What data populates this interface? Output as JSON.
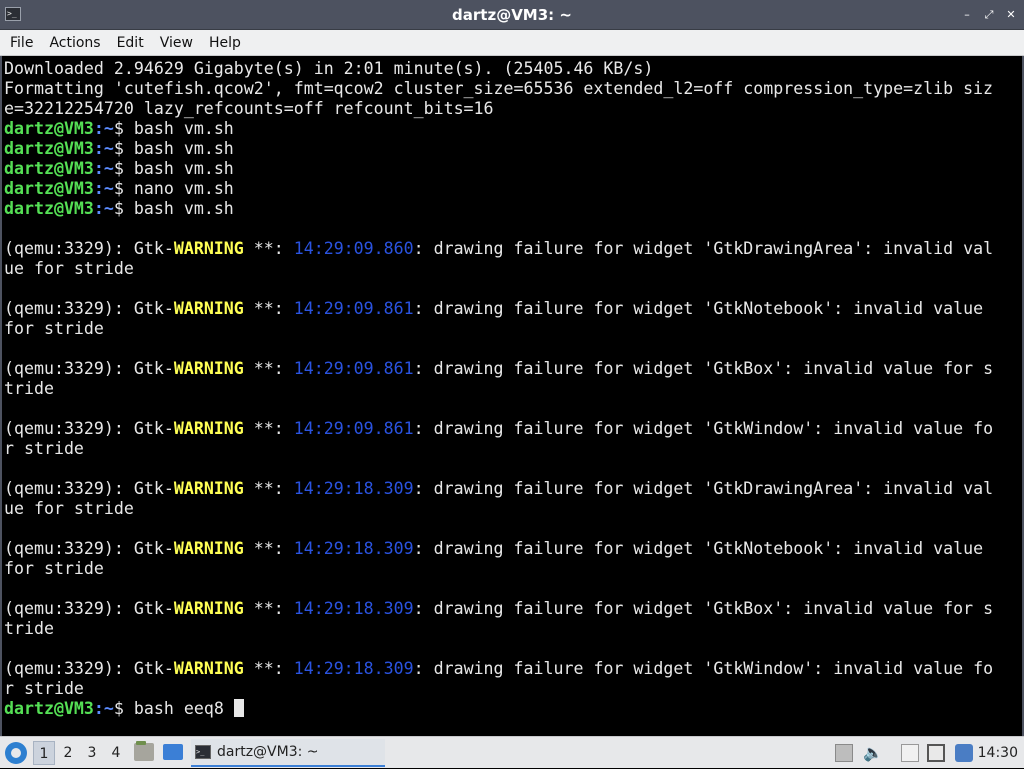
{
  "window": {
    "title": "dartz@VM3: ~",
    "app_icon_glyph": ">_",
    "buttons": {
      "minimize": "–",
      "restore": "⤢",
      "close": "✕"
    }
  },
  "menu": {
    "items": [
      "File",
      "Actions",
      "Edit",
      "View",
      "Help"
    ]
  },
  "terminal": {
    "prompt_user": "dartz@VM3",
    "prompt_path": ":~",
    "prompt_symbol": "$ ",
    "lines": [
      {
        "kind": "text",
        "text": "Downloaded 2.94629 Gigabyte(s) in 2:01 minute(s). (25405.46 KB/s)"
      },
      {
        "kind": "text",
        "text": "Formatting 'cutefish.qcow2', fmt=qcow2 cluster_size=65536 extended_l2=off compression_type=zlib siz"
      },
      {
        "kind": "text",
        "text": "e=32212254720 lazy_refcounts=off refcount_bits=16"
      },
      {
        "kind": "prompt",
        "cmd": "bash vm.sh"
      },
      {
        "kind": "prompt",
        "cmd": "bash vm.sh"
      },
      {
        "kind": "prompt",
        "cmd": "bash vm.sh"
      },
      {
        "kind": "prompt",
        "cmd": "nano vm.sh"
      },
      {
        "kind": "prompt",
        "cmd": "bash vm.sh"
      },
      {
        "kind": "blank"
      },
      {
        "kind": "warn",
        "pre": "(qemu:3329): Gtk-",
        "word": "WARNING",
        "mid": " **: ",
        "ts": "14:29:09.860",
        "post": ": drawing failure for widget 'GtkDrawingArea': invalid val"
      },
      {
        "kind": "text",
        "text": "ue for stride"
      },
      {
        "kind": "blank"
      },
      {
        "kind": "warn",
        "pre": "(qemu:3329): Gtk-",
        "word": "WARNING",
        "mid": " **: ",
        "ts": "14:29:09.861",
        "post": ": drawing failure for widget 'GtkNotebook': invalid value"
      },
      {
        "kind": "text",
        "text": "for stride"
      },
      {
        "kind": "blank"
      },
      {
        "kind": "warn",
        "pre": "(qemu:3329): Gtk-",
        "word": "WARNING",
        "mid": " **: ",
        "ts": "14:29:09.861",
        "post": ": drawing failure for widget 'GtkBox': invalid value for s"
      },
      {
        "kind": "text",
        "text": "tride"
      },
      {
        "kind": "blank"
      },
      {
        "kind": "warn",
        "pre": "(qemu:3329): Gtk-",
        "word": "WARNING",
        "mid": " **: ",
        "ts": "14:29:09.861",
        "post": ": drawing failure for widget 'GtkWindow': invalid value fo"
      },
      {
        "kind": "text",
        "text": "r stride"
      },
      {
        "kind": "blank"
      },
      {
        "kind": "warn",
        "pre": "(qemu:3329): Gtk-",
        "word": "WARNING",
        "mid": " **: ",
        "ts": "14:29:18.309",
        "post": ": drawing failure for widget 'GtkDrawingArea': invalid val"
      },
      {
        "kind": "text",
        "text": "ue for stride"
      },
      {
        "kind": "blank"
      },
      {
        "kind": "warn",
        "pre": "(qemu:3329): Gtk-",
        "word": "WARNING",
        "mid": " **: ",
        "ts": "14:29:18.309",
        "post": ": drawing failure for widget 'GtkNotebook': invalid value"
      },
      {
        "kind": "text",
        "text": "for stride"
      },
      {
        "kind": "blank"
      },
      {
        "kind": "warn",
        "pre": "(qemu:3329): Gtk-",
        "word": "WARNING",
        "mid": " **: ",
        "ts": "14:29:18.309",
        "post": ": drawing failure for widget 'GtkBox': invalid value for s"
      },
      {
        "kind": "text",
        "text": "tride"
      },
      {
        "kind": "blank"
      },
      {
        "kind": "warn",
        "pre": "(qemu:3329): Gtk-",
        "word": "WARNING",
        "mid": " **: ",
        "ts": "14:29:18.309",
        "post": ": drawing failure for widget 'GtkWindow': invalid value fo"
      },
      {
        "kind": "text",
        "text": "r stride"
      },
      {
        "kind": "current",
        "cmd": "bash eeq8 "
      }
    ]
  },
  "taskbar": {
    "workspaces": [
      "1",
      "2",
      "3",
      "4"
    ],
    "active_workspace": "1",
    "task_label": "dartz@VM3: ~",
    "volume_glyph": "🔈",
    "clock": "14:30"
  }
}
